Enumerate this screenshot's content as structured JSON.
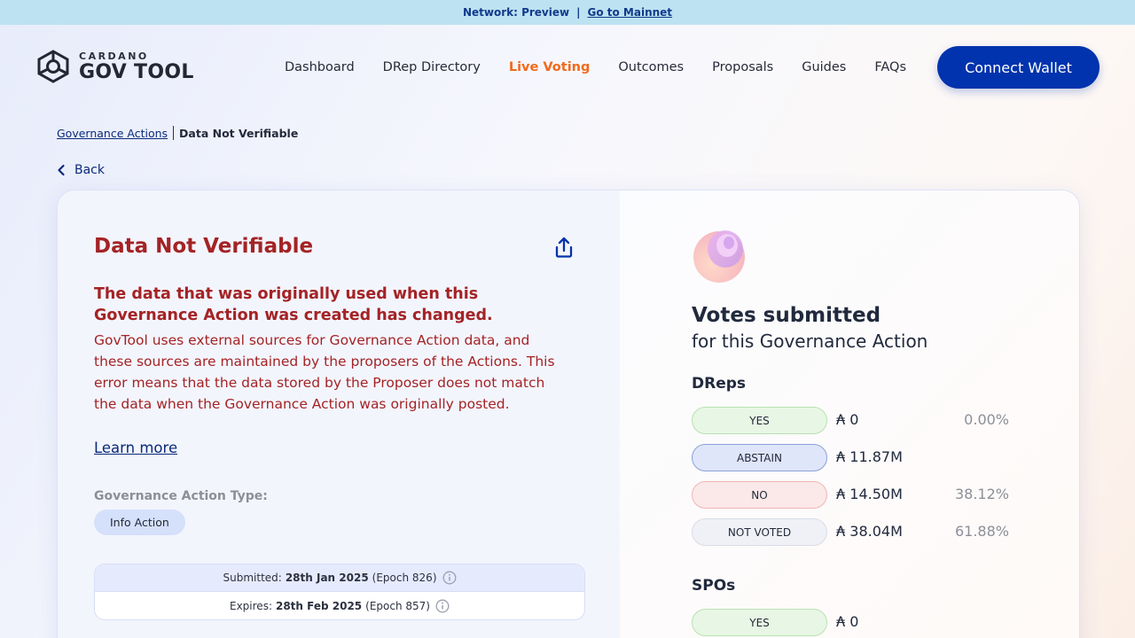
{
  "network_bar": {
    "network_label": "Network: Preview",
    "separator": "|",
    "mainnet_link": "Go to Mainnet"
  },
  "header": {
    "logo_small": "CARDANO",
    "logo_big": "GOV TOOL",
    "nav": [
      {
        "label": "Dashboard"
      },
      {
        "label": "DRep Directory"
      },
      {
        "label": "Live Voting"
      },
      {
        "label": "Outcomes"
      },
      {
        "label": "Proposals"
      },
      {
        "label": "Guides"
      },
      {
        "label": "FAQs"
      }
    ],
    "active_nav": "Live Voting",
    "connect_button": "Connect Wallet"
  },
  "breadcrumb": {
    "parent": "Governance Actions",
    "current": "Data Not Verifiable"
  },
  "back_label": "Back",
  "action": {
    "title": "Data Not Verifiable",
    "error_heading": "The data that was originally used when this Governance Action was created has changed.",
    "error_body": "GovTool uses external sources for Governance Action data, and these sources are maintained by the proposers of the Actions. This error means that the data stored by the Proposer does not match the data when the Governance Action was originally posted.",
    "learn_more": "Learn more",
    "type_label": "Governance Action Type:",
    "type_value": "Info Action",
    "submitted_label": "Submitted:",
    "submitted_date": "28th Jan 2025",
    "submitted_epoch": "(Epoch 826)",
    "expires_label": "Expires:",
    "expires_date": "28th Feb 2025",
    "expires_epoch": "(Epoch 857)"
  },
  "votes": {
    "title": "Votes submitted",
    "subtitle": "for this Governance Action",
    "dreps": {
      "label": "DReps",
      "rows": [
        {
          "label": "YES",
          "amount": "₳ 0",
          "percent": "0.00%"
        },
        {
          "label": "ABSTAIN",
          "amount": "₳ 11.87M",
          "percent": ""
        },
        {
          "label": "NO",
          "amount": "₳ 14.50M",
          "percent": "38.12%"
        },
        {
          "label": "NOT VOTED",
          "amount": "₳ 38.04M",
          "percent": "61.88%"
        }
      ]
    },
    "spos": {
      "label": "SPOs",
      "rows": [
        {
          "label": "YES",
          "amount": "₳ 0",
          "percent": ""
        }
      ]
    }
  },
  "colors": {
    "brand_blue": "#0033ad",
    "active_orange": "#f06a1d",
    "error_red": "#a42325"
  }
}
